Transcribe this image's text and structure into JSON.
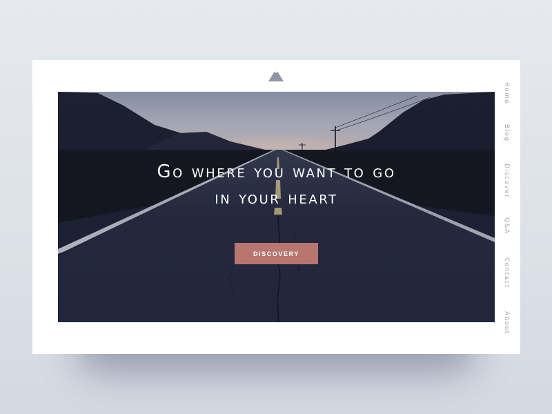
{
  "colors": {
    "background": "#e2e5ea",
    "card": "#ffffff",
    "accent_button": "#b8766f",
    "logo": "#8f95a7",
    "nav_text": "#a3a6ae",
    "headline": "#ffffff"
  },
  "header": {
    "logo_icon": "mountain-icon"
  },
  "hero": {
    "image": "dusk highway road through mountains",
    "headline_line1": "Go where you want to go",
    "headline_line2": "in your heart",
    "cta_label": "DISCOVERY"
  },
  "nav": {
    "items": [
      {
        "label": "Home"
      },
      {
        "label": "Blog"
      },
      {
        "label": "Discover"
      },
      {
        "label": "Q&A"
      },
      {
        "label": "Contact"
      },
      {
        "label": "About"
      }
    ]
  }
}
